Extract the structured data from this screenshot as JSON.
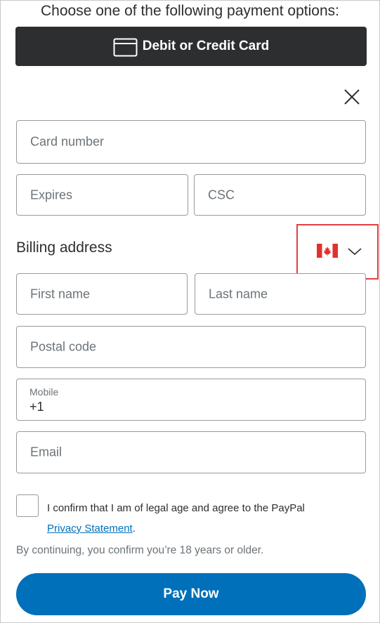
{
  "header": {
    "title": "Choose one of the following payment options:"
  },
  "payment_option": {
    "label": "Debit or Credit Card",
    "icon": "credit-card-icon"
  },
  "close": {
    "icon": "close-icon"
  },
  "card": {
    "number_placeholder": "Card number",
    "expires_placeholder": "Expires",
    "csc_placeholder": "CSC"
  },
  "billing": {
    "title": "Billing address",
    "country_icon": "canada-flag-icon",
    "first_name_placeholder": "First name",
    "last_name_placeholder": "Last name",
    "postal_code_placeholder": "Postal code",
    "mobile_label": "Mobile",
    "mobile_value": "+1",
    "email_placeholder": "Email"
  },
  "consent": {
    "text": "I confirm that I am of legal age and agree to the PayPal",
    "link": "Privacy Statement",
    "period": "."
  },
  "note": "By continuing, you confirm you’re 18 years or older.",
  "pay_button": "Pay Now",
  "colors": {
    "dark_button": "#2c2e2f",
    "primary": "#0070ba",
    "highlight": "#e53f3f",
    "flag_red": "#e0312e"
  }
}
